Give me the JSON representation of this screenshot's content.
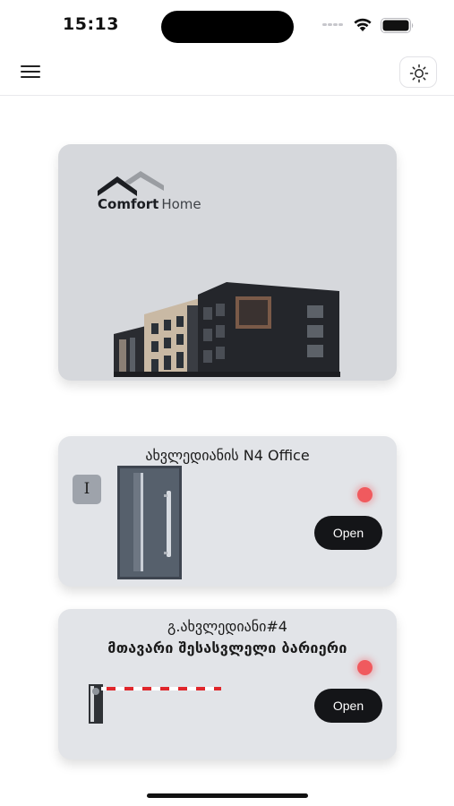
{
  "status_bar": {
    "time": "15:13"
  },
  "header": {
    "menu_icon": "hamburger-menu-icon",
    "theme_icon": "sun-icon"
  },
  "hero": {
    "logo_bold": "Comfort",
    "logo_light": "Home",
    "logo_icon": "house-roof-icon"
  },
  "devices": [
    {
      "title": "ახვლედიანის N4 Office",
      "badge": "I",
      "status_color": "#f05a5e",
      "open_label": "Open"
    },
    {
      "subtitle": "გ.ახვლედიანი#4",
      "title": "მთავარი შესასვლელი ბარიერი",
      "status_color": "#f05a5e",
      "open_label": "Open"
    }
  ],
  "colors": {
    "card_background": "#e2e4e8",
    "hero_background": "#d6d8dc",
    "button_background": "#141518",
    "status_offline": "#f05a5e"
  }
}
